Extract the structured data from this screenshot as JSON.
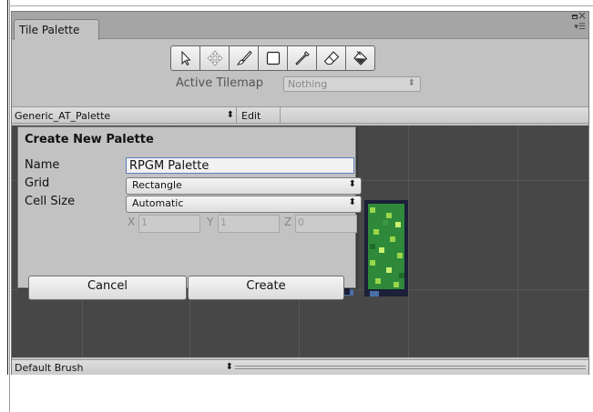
{
  "window": {
    "tab_title": "Tile Palette"
  },
  "toolbar": {
    "tools": [
      {
        "name": "select-tool",
        "icon": "arrow-pointer-icon"
      },
      {
        "name": "move-tool",
        "icon": "move-arrows-icon"
      },
      {
        "name": "paint-tool",
        "icon": "paintbrush-icon"
      },
      {
        "name": "box-fill-tool",
        "icon": "rectangle-icon"
      },
      {
        "name": "picker-tool",
        "icon": "eyedropper-icon"
      },
      {
        "name": "eraser-tool",
        "icon": "eraser-icon"
      },
      {
        "name": "fill-tool",
        "icon": "paint-bucket-icon"
      }
    ],
    "active_tilemap_label": "Active Tilemap",
    "active_tilemap_value": "Nothing"
  },
  "palette_bar": {
    "palette_name": "Generic_AT_Palette",
    "edit_label": "Edit"
  },
  "create_palette": {
    "title": "Create New Palette",
    "name_label": "Name",
    "name_value": "RPGM Palette",
    "grid_label": "Grid",
    "grid_value": "Rectangle",
    "cell_size_label": "Cell Size",
    "cell_size_value": "Automatic",
    "x_label": "X",
    "x_value": "1",
    "y_label": "Y",
    "y_value": "1",
    "z_label": "Z",
    "z_value": "0",
    "cancel_label": "Cancel",
    "create_label": "Create"
  },
  "bottom_bar": {
    "brush_name": "Default Brush"
  },
  "colors": {
    "grid_background": "#474747",
    "grid_lines": "#585858",
    "focus_border": "#5b7fc0",
    "tile_blue": "#3a5f95",
    "tile_green_dark": "#2e8a3a",
    "tile_green_light": "#9ad64a",
    "tile_navy": "#1c2038"
  }
}
